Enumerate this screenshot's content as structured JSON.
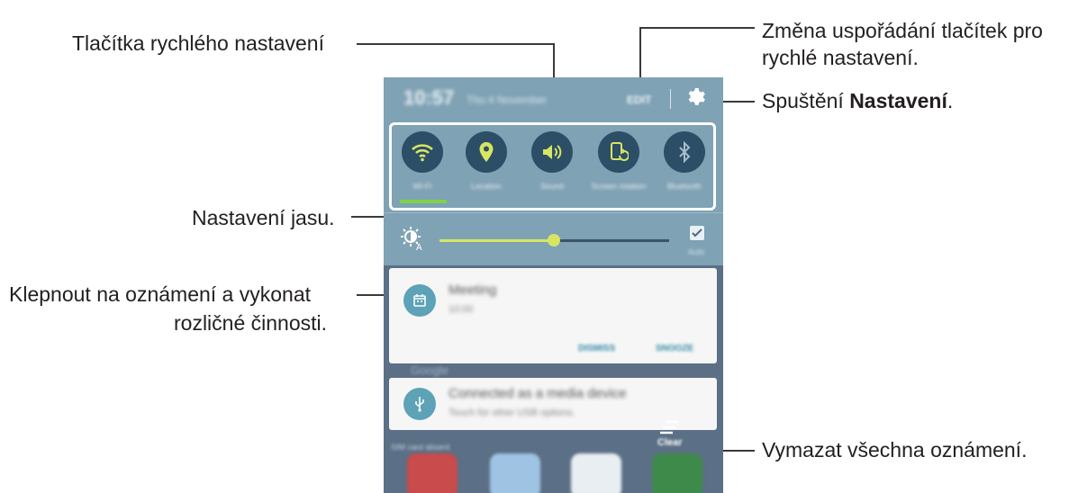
{
  "callouts": {
    "quick_settings": "Tlačítka rychlého nastavení",
    "rearrange_line1": "Změna uspořádání tlačítek pro",
    "rearrange_line2": "rychlé nastavení.",
    "launch_prefix": "Spuštění ",
    "launch_bold": "Nastavení",
    "launch_suffix": ".",
    "brightness": "Nastavení jasu.",
    "tap_line1": "Klepnout na oznámení a vykonat",
    "tap_line2": "rozličné činnosti.",
    "clear_all": "Vymazat všechna oznámení."
  },
  "phone": {
    "time": "10:57",
    "date": "Thu 4 November",
    "edit_label": "EDIT",
    "settings_icon": "gear-icon",
    "quick_buttons": [
      {
        "label": "Wi-Fi",
        "icon": "wifi-icon"
      },
      {
        "label": "Location",
        "icon": "location-pin-icon"
      },
      {
        "label": "Sound",
        "icon": "sound-icon"
      },
      {
        "label": "Screen rotation",
        "icon": "screen-rotation-icon"
      },
      {
        "label": "Bluetooth",
        "icon": "bluetooth-icon"
      }
    ],
    "brightness": {
      "level": 0.5,
      "auto_label": "Auto",
      "auto_checked": true
    },
    "notifications": [
      {
        "title": "Meeting",
        "subtitle": "10:00",
        "actions": [
          "DISMISS",
          "SNOOZE"
        ],
        "icon": "calendar-icon"
      },
      {
        "title": "Connected as a media device",
        "subtitle": "Touch for other USB options.",
        "icon": "usb-icon"
      }
    ],
    "between_text": "Google",
    "emergency_text": "SIM card absent",
    "clear_label": "Clear",
    "accent_color": "#d7e563",
    "header_color": "#7fa2b4"
  }
}
